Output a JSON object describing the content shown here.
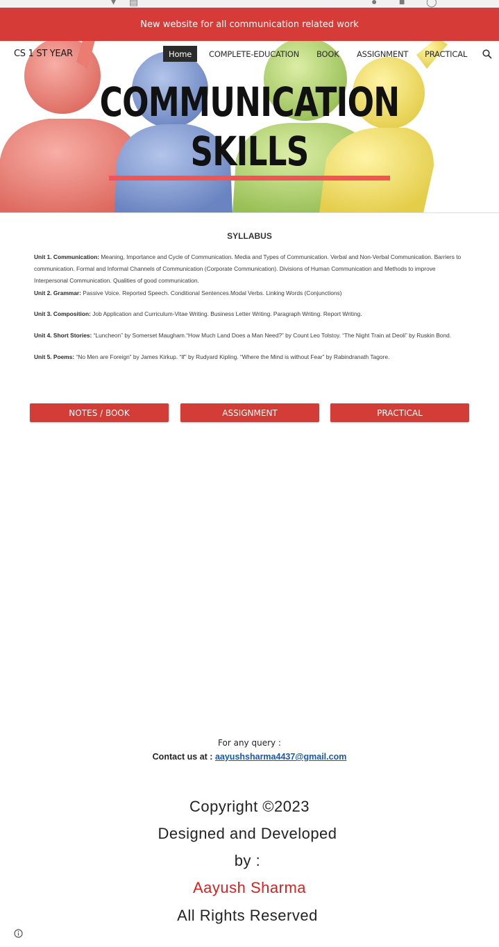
{
  "banner": {
    "text": "New website for all communication related work"
  },
  "hero": {
    "title_line1": "COMMUNICATION",
    "title_line2": "SKILLS"
  },
  "site": {
    "title": "CS 1 ST YEAR"
  },
  "nav": {
    "items": [
      {
        "label": "Home",
        "active": true
      },
      {
        "label": "COMPLETE-EDUCATION"
      },
      {
        "label": "BOOK"
      },
      {
        "label": "ASSIGNMENT"
      },
      {
        "label": "PRACTICAL"
      }
    ],
    "search_icon": "search-icon"
  },
  "syllabus": {
    "title": "SYLLABUS",
    "units": [
      {
        "label": "Unit 1. Communication:",
        "text": " Meaning, Importance and Cycle of Communication. Media and Types of Communication. Verbal and Non-Verbal Communication. Barriers to communication. Formal and Informal Channels of Communication (Corporate Communication). Divisions of Human Communication and Methods to improve Interpersonal Communication. Qualities of good communication."
      },
      {
        "label": "Unit 2. Grammar:",
        "text": " Passive Voice. Reported Speech. Conditional Sentences.Modal Verbs. Linking Words (Conjunctions)"
      },
      {
        "label": "Unit 3. Composition:",
        "text": " Job Application and Curriculum-Vitae Writing. Business Letter Writing. Paragraph Writing. Report Writing."
      },
      {
        "label": "Unit 4. Short Stories:",
        "text": " “Luncheon” by Somerset Maugham.“How Much Land Does a Man Need?” by Count Leo Tolstoy. “The Night Train at Deoli” by Ruskin Bond."
      },
      {
        "label": "Unit 5. Poems:",
        "text": " “No Men are Foreign” by James Kirkup. “If” by Rudyard Kipling. “Where the Mind is without Fear” by Rabindranath Tagore."
      }
    ]
  },
  "buttons": {
    "notes": "NOTES / BOOK",
    "assignment": "ASSIGNMENT",
    "practical": "PRACTICAL"
  },
  "contact": {
    "query": "For any query :",
    "label": "Contact us at : ",
    "email": "aayushsharma4437@gmail.com"
  },
  "footer": {
    "copyright": "Copyright  ©2023",
    "designed": "Designed and Developed",
    "by": "by :",
    "author": "Aayush Sharma",
    "rights": "All Rights Reserved"
  },
  "colors": {
    "banner": "#d63b38",
    "button": "#d43c38",
    "author": "#d92020",
    "link": "#1a56b0"
  }
}
